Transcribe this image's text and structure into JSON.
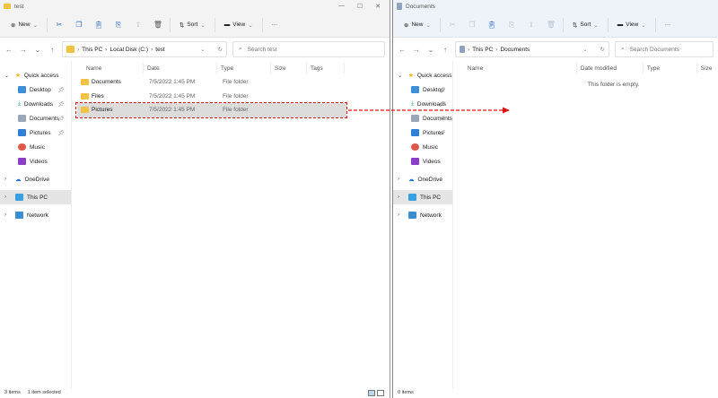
{
  "colors": {
    "accent": "#2a6bc2",
    "arrow": "#e01010",
    "folder": "#f2c343"
  },
  "left": {
    "title": "test",
    "toolbar": {
      "new": "New",
      "sort": "Sort",
      "view": "View",
      "more": "···"
    },
    "crumbs": [
      "This PC",
      "Local Disk (C:)",
      "test"
    ],
    "search_placeholder": "Search test",
    "columns": [
      "Name",
      "Date",
      "Type",
      "Size",
      "Tags"
    ],
    "rows": [
      {
        "name": "Documents",
        "date": "7/5/2022 1:45 PM",
        "type": "File folder"
      },
      {
        "name": "Files",
        "date": "7/5/2022 1:45 PM",
        "type": "File folder"
      },
      {
        "name": "Pictures",
        "date": "7/5/2022 1:45 PM",
        "type": "File folder"
      }
    ],
    "status": {
      "items": "3 items",
      "selected": "1 item selected"
    }
  },
  "right": {
    "title": "Documents",
    "toolbar": {
      "new": "New",
      "sort": "Sort",
      "view": "View",
      "more": "···"
    },
    "crumbs": [
      "This PC",
      "Documents"
    ],
    "search_placeholder": "Search Documents",
    "columns": [
      "Name",
      "Date modified",
      "Type",
      "Size"
    ],
    "empty": "This folder is empty.",
    "status": {
      "items": "0 items"
    }
  },
  "sidebar": {
    "quick_access": "Quick access",
    "desktop": "Desktop",
    "downloads": "Downloads",
    "documents": "Documents",
    "pictures": "Pictures",
    "music": "Music",
    "videos": "Videos",
    "onedrive": "OneDrive",
    "thispc": "This PC",
    "network": "Network"
  }
}
